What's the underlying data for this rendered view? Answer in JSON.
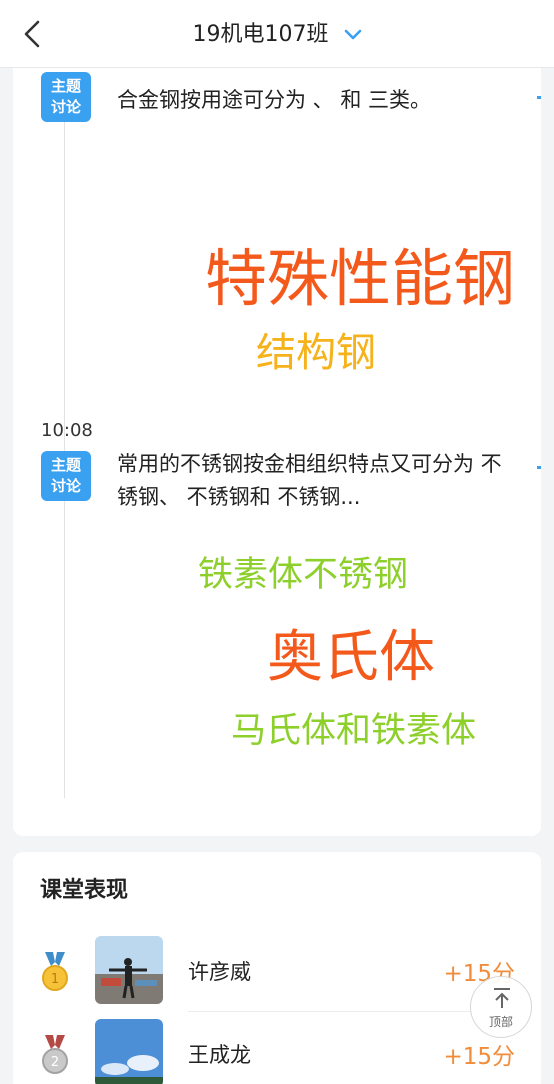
{
  "header": {
    "title": "19机电107班",
    "back_icon": "back-arrow-icon",
    "dropdown_icon": "chevron-down-icon",
    "accent": "#3aa0f0"
  },
  "feed": {
    "items": [
      {
        "tag_line1": "主题",
        "tag_line2": "讨论",
        "time": "",
        "question": "合金钢按用途可分为 、 和 三类。",
        "words": [
          {
            "text": "特殊性能钢",
            "color": "#f4591c"
          },
          {
            "text": "结构钢",
            "color": "#f6b21a"
          }
        ]
      },
      {
        "tag_line1": "主题",
        "tag_line2": "讨论",
        "time": "10:08",
        "question": "常用的不锈钢按金相组织特点又可分为 不锈钢、 不锈钢和 不锈钢...",
        "words": [
          {
            "text": "铁素体不锈钢",
            "color": "#8dcf2b"
          },
          {
            "text": "奥氏体",
            "color": "#f4591c"
          },
          {
            "text": "马氏体和铁素体",
            "color": "#8dcf2b"
          }
        ]
      }
    ]
  },
  "performance": {
    "title": "课堂表现",
    "rows": [
      {
        "rank": "1",
        "name": "许彦威",
        "score": "+15分",
        "medal_icon": "gold-medal-icon"
      },
      {
        "rank": "2",
        "name": "王成龙",
        "score": "+15分",
        "medal_icon": "silver-medal-icon"
      }
    ],
    "score_color": "#f08c3a"
  },
  "back_to_top": {
    "label": "顶部",
    "icon": "arrow-up-icon"
  }
}
